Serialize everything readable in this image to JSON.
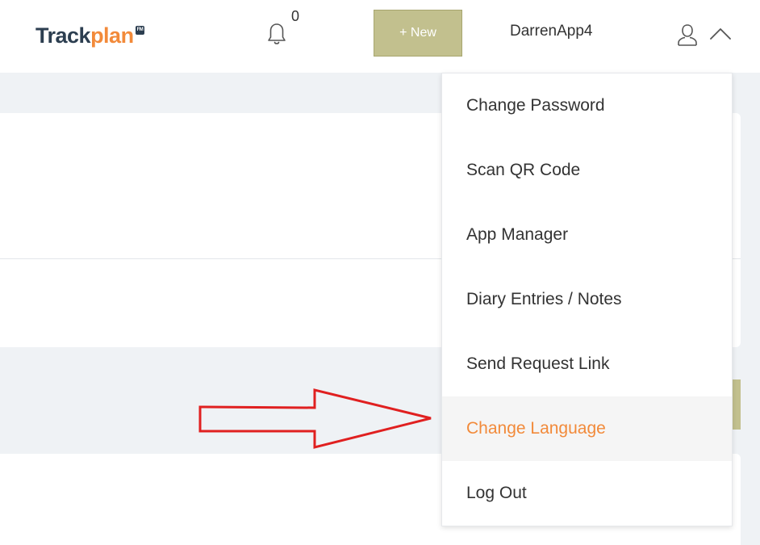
{
  "header": {
    "logo": {
      "part1": "Track",
      "part2": "plan",
      "badge": "FM"
    },
    "notifications": {
      "icon": "bell-icon",
      "count": "0"
    },
    "new_button_label": "+ New",
    "username": "DarrenApp4",
    "user_icon": "user-icon",
    "menu_toggle_icon": "chevron-up-icon"
  },
  "user_menu": {
    "items": [
      {
        "label": "Change Password"
      },
      {
        "label": "Scan QR Code"
      },
      {
        "label": "App Manager"
      },
      {
        "label": "Diary Entries / Notes"
      },
      {
        "label": "Send Request Link"
      },
      {
        "label": "Change Language",
        "state": "highlighted"
      },
      {
        "label": "Log Out"
      }
    ]
  },
  "annotation": {
    "icon": "right-arrow-icon",
    "color": "#e02020",
    "points_to": "Change Language"
  },
  "colors": {
    "brand_dark": "#2c3e50",
    "brand_orange": "#f28a3a",
    "new_button_bg": "#c2c08e",
    "page_bg": "#eff2f5",
    "active_item_bg": "#f5f5f5"
  }
}
